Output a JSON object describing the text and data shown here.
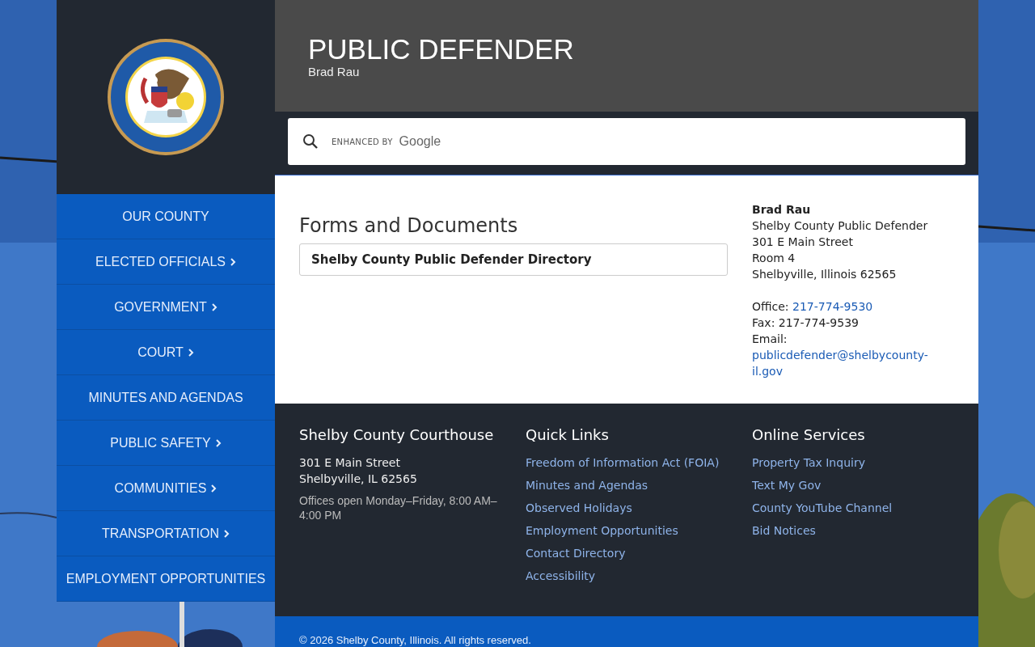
{
  "nav": [
    {
      "label": "OUR COUNTY",
      "has_submenu": false
    },
    {
      "label": "ELECTED OFFICIALS",
      "has_submenu": true
    },
    {
      "label": "GOVERNMENT",
      "has_submenu": true
    },
    {
      "label": "COURT",
      "has_submenu": true
    },
    {
      "label": "MINUTES AND AGENDAS",
      "has_submenu": false
    },
    {
      "label": "PUBLIC SAFETY",
      "has_submenu": true
    },
    {
      "label": "COMMUNITIES",
      "has_submenu": true
    },
    {
      "label": "TRANSPORTATION",
      "has_submenu": true
    },
    {
      "label": "EMPLOYMENT OPPORTUNITIES",
      "has_submenu": false
    }
  ],
  "header": {
    "title": "PUBLIC DEFENDER",
    "subtitle": "Brad Rau"
  },
  "search": {
    "enhanced_by": "ENHANCED BY",
    "brand": "Google"
  },
  "main": {
    "heading": "Forms and Documents",
    "documents": [
      "Shelby County Public Defender Directory"
    ]
  },
  "contact": {
    "name": "Brad Rau",
    "lines": [
      "Shelby County Public Defender",
      "301 E Main Street",
      "Room 4",
      "Shelbyville, Illinois 62565"
    ],
    "office_label": "Office:",
    "office_phone": "217-774-9530",
    "fax": "Fax: 217-774-9539",
    "email_label": "Email:",
    "email": "publicdefender@shelbycounty-il.gov"
  },
  "footer": {
    "columns": [
      {
        "title": "Shelby County Courthouse",
        "address": [
          "301 E Main Street",
          "Shelbyville, IL 62565"
        ],
        "note": "Offices open Monday–Friday, 8:00 AM–4:00 PM"
      },
      {
        "title": "Quick Links",
        "links": [
          "Freedom of Information Act (FOIA)",
          "Minutes and Agendas",
          "Observed Holidays",
          "Employment Opportunities",
          "Contact Directory",
          "Accessibility"
        ]
      },
      {
        "title": "Online Services",
        "links": [
          "Property Tax Inquiry",
          "Text My Gov",
          "County YouTube Channel",
          "Bid Notices"
        ]
      }
    ],
    "copyright": "© 2026 Shelby County, Illinois. All rights reserved."
  }
}
